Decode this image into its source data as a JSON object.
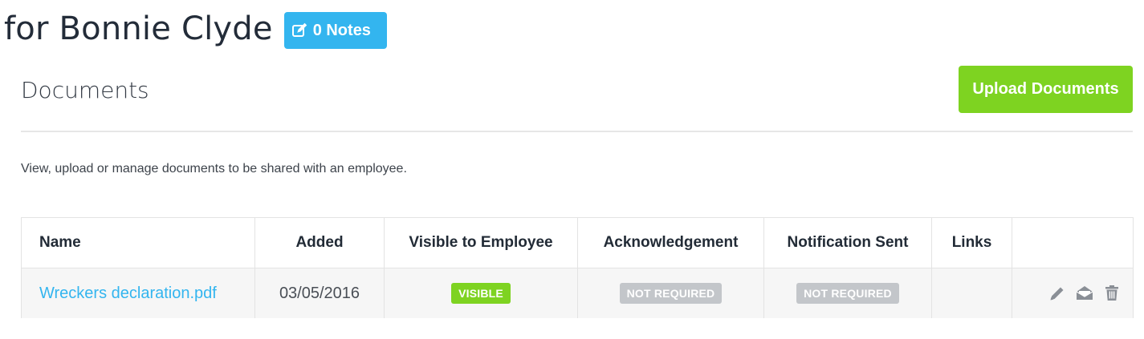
{
  "header": {
    "title": "for Bonnie Clyde",
    "notes_label": "0 Notes",
    "notes_icon": "edit-note-icon"
  },
  "section": {
    "title": "Documents",
    "upload_label": "Upload Documents",
    "description": "View, upload or manage documents to be shared with an employee."
  },
  "table": {
    "headers": {
      "name": "Name",
      "added": "Added",
      "visible": "Visible to Employee",
      "ack": "Acknowledgement",
      "notification": "Notification Sent",
      "links": "Links",
      "actions": ""
    },
    "rows": [
      {
        "name": "Wreckers declaration.pdf",
        "added": "03/05/2016",
        "visible": "VISIBLE",
        "ack": "NOT REQUIRED",
        "notification": "NOT REQUIRED",
        "links": "",
        "action_icons": [
          "pencil-icon",
          "envelope-open-icon",
          "trash-icon"
        ]
      }
    ]
  },
  "colors": {
    "primary_blue": "#33b5ef",
    "success_green": "#7ed321",
    "muted_badge": "#c3c6ca",
    "icon_gray": "#8a8f96"
  }
}
